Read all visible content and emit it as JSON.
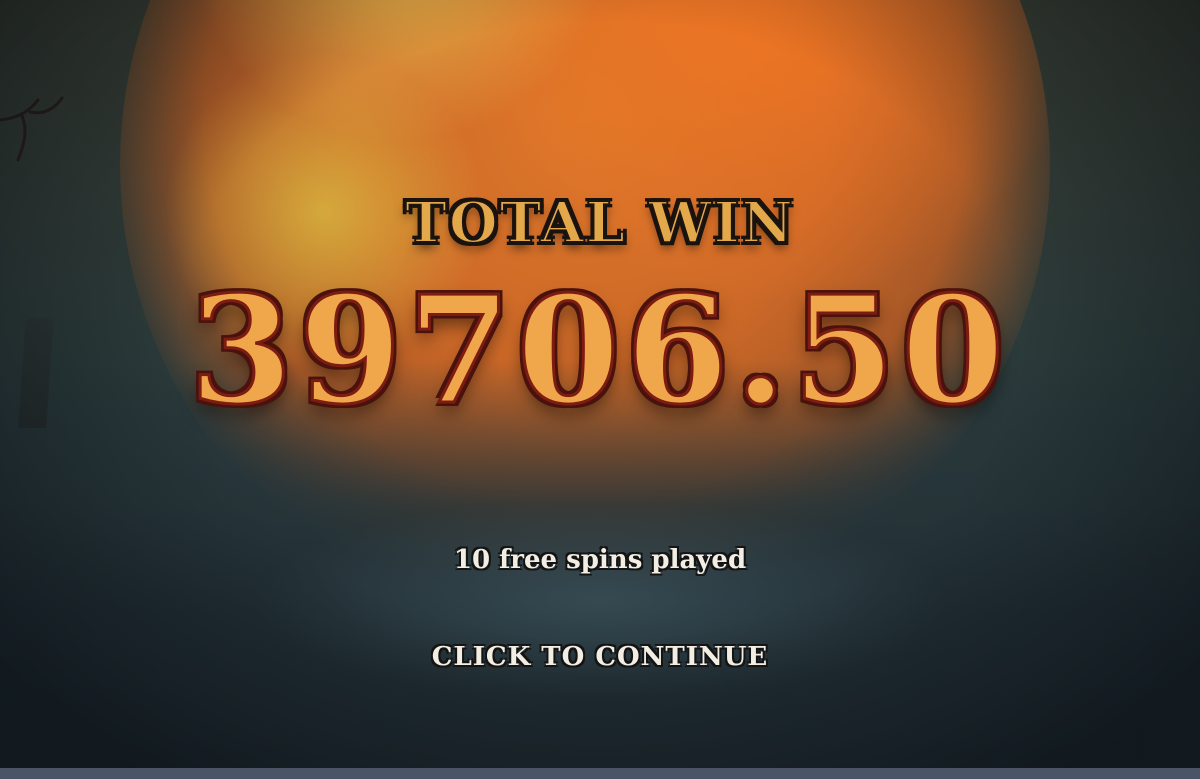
{
  "screen": {
    "total_win_label": "TOTAL WIN",
    "total_win_amount": "39706.50",
    "spins_played_text": "10 free spins played",
    "continue_label": "CLICK TO CONTINUE"
  },
  "colors": {
    "accent_gold": "#e3a84a",
    "amount_orange": "#f0a64a",
    "amount_outline": "#7d1d12",
    "text_light": "#f2eee4"
  }
}
